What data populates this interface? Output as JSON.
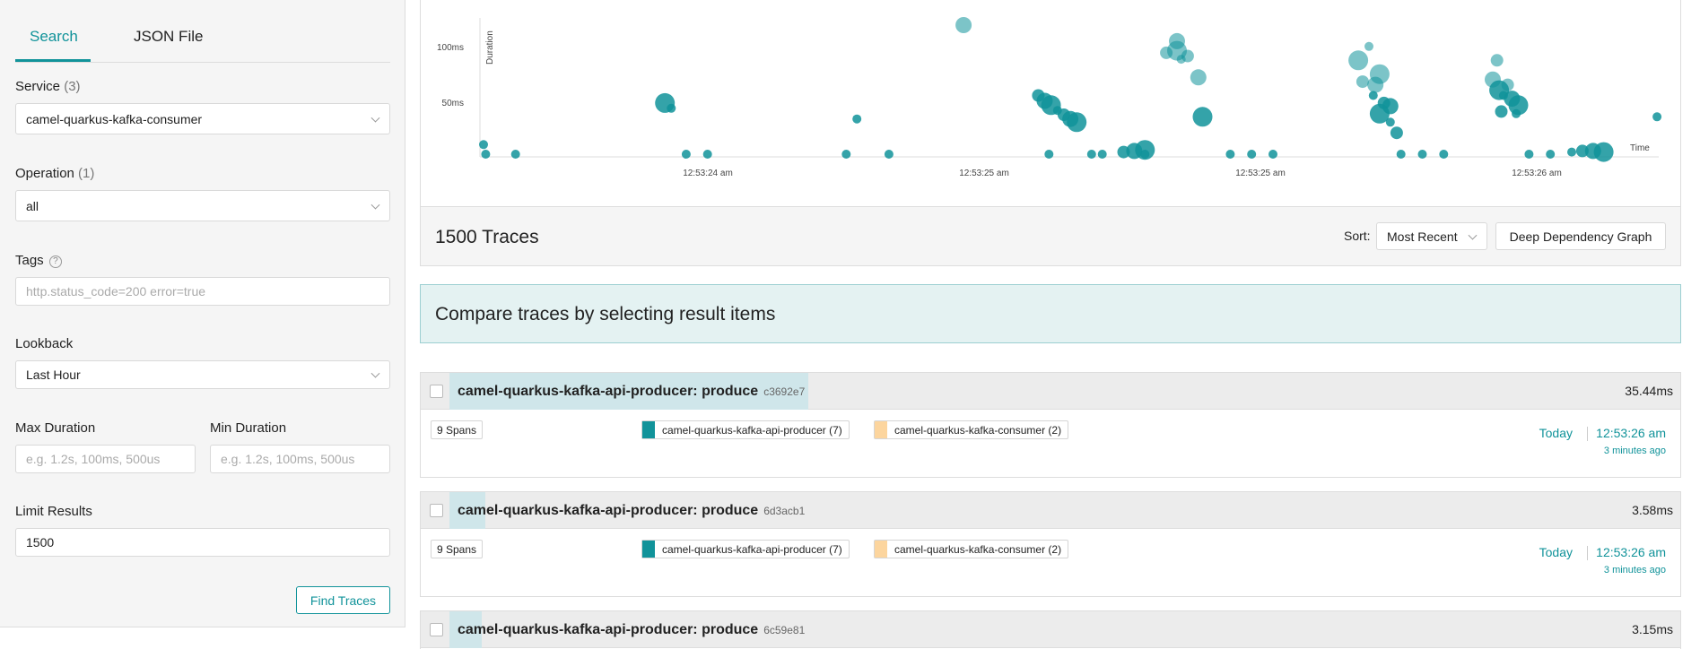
{
  "search_panel": {
    "tabs": [
      {
        "label": "Search"
      },
      {
        "label": "JSON File"
      }
    ],
    "service": {
      "label": "Service",
      "count": "(3)",
      "value": "camel-quarkus-kafka-consumer"
    },
    "operation": {
      "label": "Operation",
      "count": "(1)",
      "value": "all"
    },
    "tags": {
      "label": "Tags",
      "help": "?",
      "placeholder": "http.status_code=200 error=true"
    },
    "lookback": {
      "label": "Lookback",
      "value": "Last Hour"
    },
    "max_duration": {
      "label": "Max Duration",
      "placeholder": "e.g. 1.2s, 100ms, 500us"
    },
    "min_duration": {
      "label": "Min Duration",
      "placeholder": "e.g. 1.2s, 100ms, 500us"
    },
    "limit": {
      "label": "Limit Results",
      "value": "1500"
    },
    "find_button": "Find Traces"
  },
  "chart_data": {
    "type": "scatter",
    "xlabel": "Time",
    "ylabel": "Duration",
    "y_ticks": [
      "100ms",
      "50ms"
    ],
    "x_ticks": [
      "12:53:24 am",
      "12:53:25 am",
      "12:53:25 am",
      "12:53:26 am"
    ],
    "point_color": "#11939a",
    "series": [
      {
        "values": [
          {
            "x": 0.0,
            "y": 9
          },
          {
            "x": 0.01,
            "y": 0
          },
          {
            "x": 0.15,
            "y": 0
          },
          {
            "x": 0.85,
            "y": 48
          },
          {
            "x": 0.88,
            "y": 43
          },
          {
            "x": 0.95,
            "y": 0
          },
          {
            "x": 1.05,
            "y": 0
          },
          {
            "x": 1.7,
            "y": 0
          },
          {
            "x": 1.75,
            "y": 33
          },
          {
            "x": 1.9,
            "y": 0
          },
          {
            "x": 2.25,
            "y": 121
          },
          {
            "x": 2.65,
            "y": 0
          },
          {
            "x": 2.85,
            "y": 0
          },
          {
            "x": 2.6,
            "y": 55
          },
          {
            "x": 2.63,
            "y": 50
          },
          {
            "x": 2.66,
            "y": 46
          },
          {
            "x": 2.69,
            "y": 41
          },
          {
            "x": 2.72,
            "y": 37
          },
          {
            "x": 2.75,
            "y": 33
          },
          {
            "x": 2.78,
            "y": 30
          },
          {
            "x": 2.9,
            "y": 0
          },
          {
            "x": 3.0,
            "y": 2
          },
          {
            "x": 3.05,
            "y": 3
          },
          {
            "x": 3.1,
            "y": 4
          },
          {
            "x": 3.1,
            "y": 0
          },
          {
            "x": 3.2,
            "y": 95
          },
          {
            "x": 3.25,
            "y": 106
          },
          {
            "x": 3.25,
            "y": 97
          },
          {
            "x": 3.27,
            "y": 89
          },
          {
            "x": 3.3,
            "y": 92
          },
          {
            "x": 3.35,
            "y": 72
          },
          {
            "x": 3.37,
            "y": 35
          },
          {
            "x": 3.5,
            "y": 0
          },
          {
            "x": 3.6,
            "y": 0
          },
          {
            "x": 3.7,
            "y": 0
          },
          {
            "x": 4.1,
            "y": 88
          },
          {
            "x": 4.15,
            "y": 101
          },
          {
            "x": 4.12,
            "y": 68
          },
          {
            "x": 4.18,
            "y": 65
          },
          {
            "x": 4.2,
            "y": 75
          },
          {
            "x": 4.17,
            "y": 55
          },
          {
            "x": 4.22,
            "y": 48
          },
          {
            "x": 4.25,
            "y": 45
          },
          {
            "x": 4.2,
            "y": 38
          },
          {
            "x": 4.25,
            "y": 30
          },
          {
            "x": 4.28,
            "y": 20
          },
          {
            "x": 4.3,
            "y": 0
          },
          {
            "x": 4.4,
            "y": 0
          },
          {
            "x": 4.5,
            "y": 0
          },
          {
            "x": 4.75,
            "y": 88
          },
          {
            "x": 4.73,
            "y": 70
          },
          {
            "x": 4.76,
            "y": 60
          },
          {
            "x": 4.78,
            "y": 55
          },
          {
            "x": 4.8,
            "y": 65
          },
          {
            "x": 4.82,
            "y": 52
          },
          {
            "x": 4.85,
            "y": 46
          },
          {
            "x": 4.84,
            "y": 38
          },
          {
            "x": 4.77,
            "y": 40
          },
          {
            "x": 4.9,
            "y": 0
          },
          {
            "x": 5.0,
            "y": 0
          },
          {
            "x": 5.1,
            "y": 2
          },
          {
            "x": 5.15,
            "y": 3
          },
          {
            "x": 5.2,
            "y": 3
          },
          {
            "x": 5.25,
            "y": 2
          },
          {
            "x": 5.5,
            "y": 35
          }
        ]
      }
    ]
  },
  "results": {
    "count": "1500 Traces",
    "sort_label": "Sort:",
    "sort_value": "Most Recent",
    "ddg_button": "Deep Dependency Graph",
    "compare_text": "Compare traces by selecting result items"
  },
  "traces": [
    {
      "name": "camel-quarkus-kafka-api-producer: produce",
      "id": "c3692e7",
      "duration": "35.44ms",
      "duration_ratio": 1.0,
      "spans": "9 Spans",
      "services": [
        {
          "name": "camel-quarkus-kafka-api-producer (7)",
          "color": "#11939a"
        },
        {
          "name": "camel-quarkus-kafka-consumer (2)",
          "color": "#fcd59e"
        }
      ],
      "day": "Today",
      "time": "12:53:26 am",
      "ago": "3 minutes ago"
    },
    {
      "name": "camel-quarkus-kafka-api-producer: produce",
      "id": "6d3acb1",
      "duration": "3.58ms",
      "duration_ratio": 0.101,
      "spans": "9 Spans",
      "services": [
        {
          "name": "camel-quarkus-kafka-api-producer (7)",
          "color": "#11939a"
        },
        {
          "name": "camel-quarkus-kafka-consumer (2)",
          "color": "#fcd59e"
        }
      ],
      "day": "Today",
      "time": "12:53:26 am",
      "ago": "3 minutes ago"
    },
    {
      "name": "camel-quarkus-kafka-api-producer: produce",
      "id": "6c59e81",
      "duration": "3.15ms",
      "duration_ratio": 0.089
    }
  ]
}
